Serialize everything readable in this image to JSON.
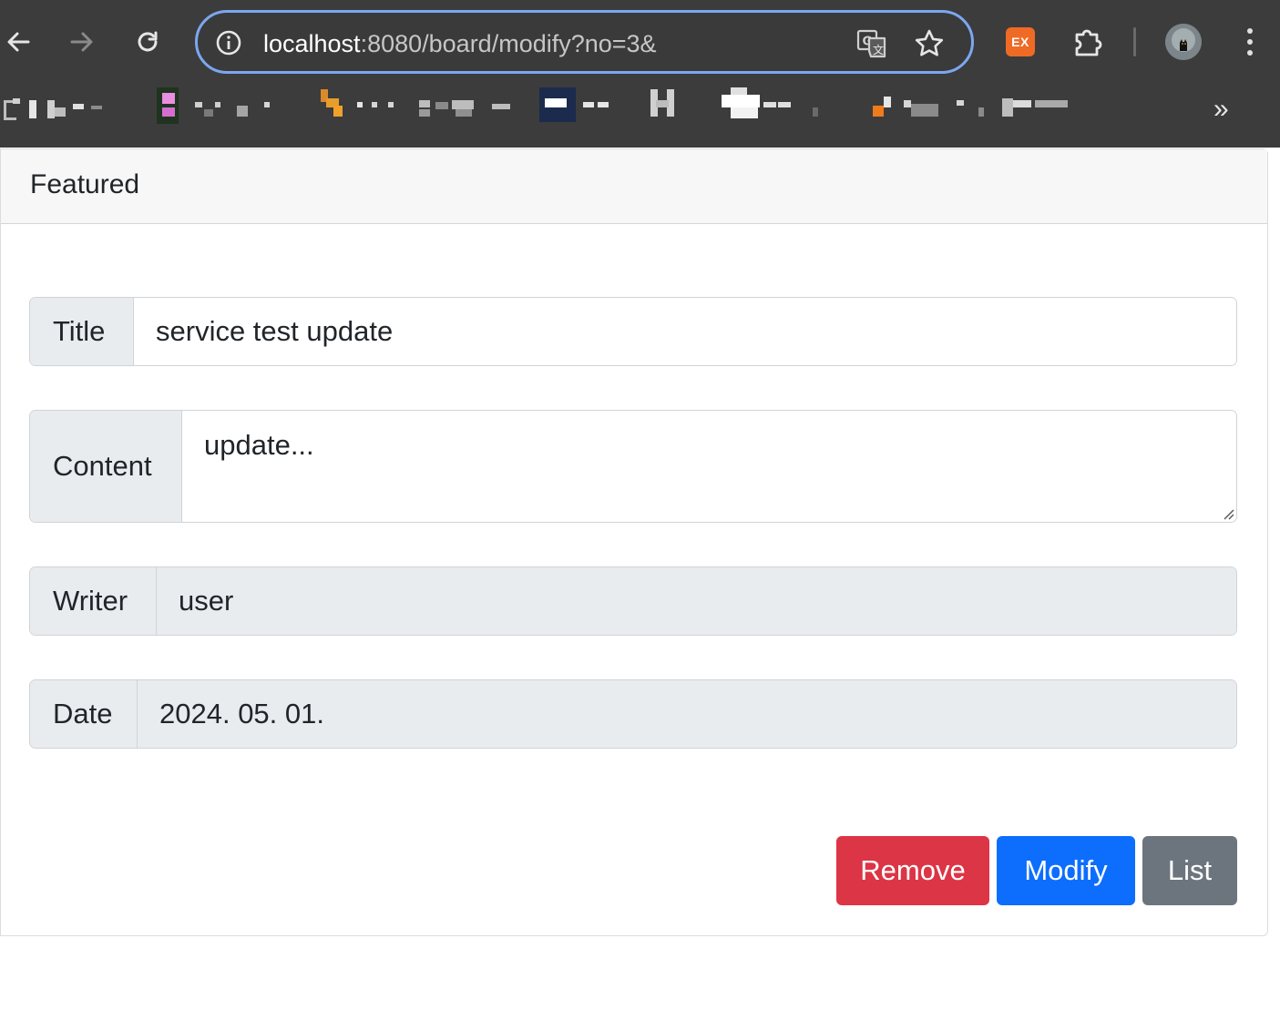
{
  "browser": {
    "url_host": "localhost",
    "url_path": ":8080/board/modify?no=3&",
    "extension_badge": "EX",
    "bookmarks_overflow": "»",
    "icons": [
      "back-arrow-icon",
      "forward-arrow-icon",
      "reload-icon",
      "site-info-icon",
      "translate-icon",
      "bookmark-star-icon",
      "extensions-puzzle-icon",
      "profile-avatar",
      "more-menu-icon"
    ]
  },
  "card": {
    "header": "Featured"
  },
  "form": {
    "title_label": "Title",
    "title_value": "service test update",
    "content_label": "Content",
    "content_value": "update...",
    "writer_label": "Writer",
    "writer_value": "user",
    "date_label": "Date",
    "date_value": "2024. 05. 01."
  },
  "actions": {
    "remove": "Remove",
    "modify": "Modify",
    "list": "List"
  },
  "colors": {
    "remove": "#dc3545",
    "modify": "#0d6efd",
    "list": "#6c757d",
    "omnibox_focus": "#7ca7f0",
    "chrome_bg": "#3c3c3c"
  }
}
